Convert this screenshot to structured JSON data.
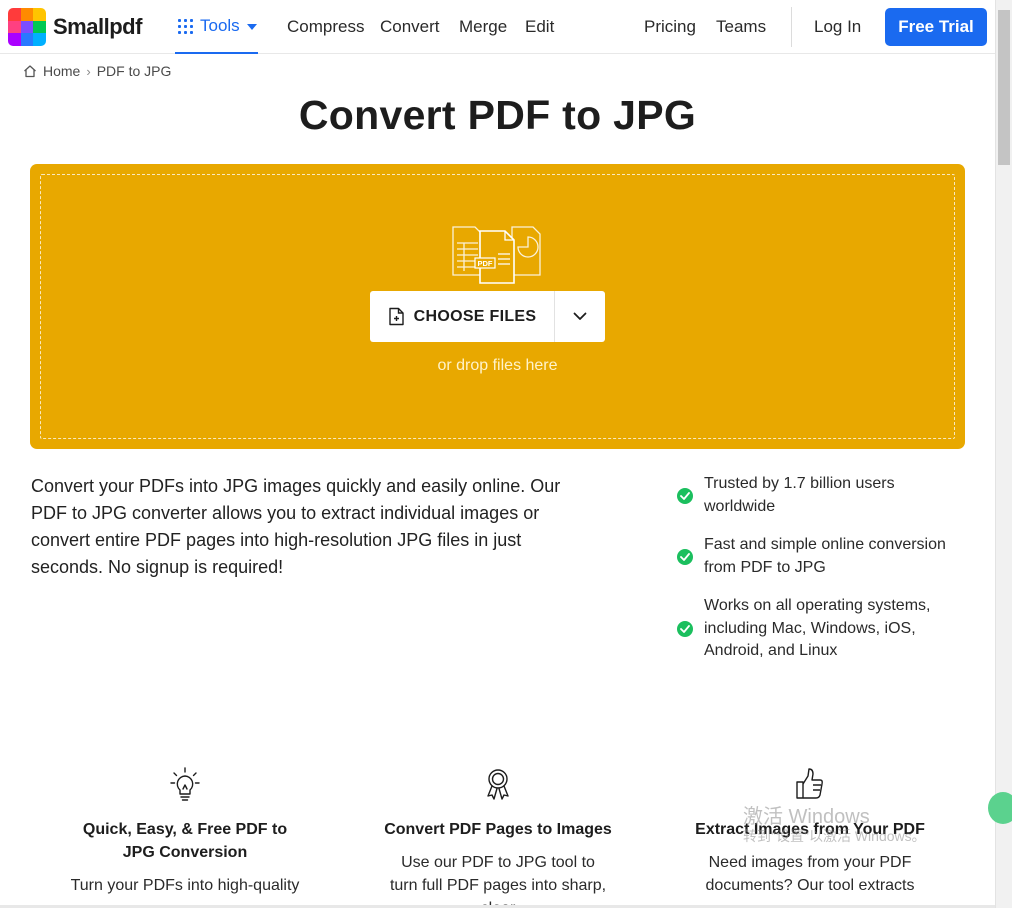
{
  "brand": {
    "name": "Smallpdf",
    "logo_colors": [
      "#ff3b3b",
      "#ff8a00",
      "#ffc400",
      "#00c853",
      "#00b0ff",
      "#7c4dff",
      "#ff4081",
      "#2979ff",
      "#aa00ff"
    ]
  },
  "nav": {
    "tools_label": "Tools",
    "links": [
      "Compress",
      "Convert",
      "Merge",
      "Edit"
    ],
    "pricing": "Pricing",
    "teams": "Teams",
    "login": "Log In",
    "trial": "Free Trial"
  },
  "breadcrumb": {
    "home": "Home",
    "current": "PDF to JPG"
  },
  "title": "Convert PDF to JPG",
  "dropzone": {
    "choose_label": "CHOOSE FILES",
    "hint": "or drop files here",
    "accent": "#e8a800"
  },
  "intro": "Convert your PDFs into JPG images quickly and easily online. Our PDF to JPG converter allows you to extract individual images or convert entire PDF pages into high-resolution JPG files in just seconds. No signup is required!",
  "features": [
    "Trusted by 1.7 billion users worldwide",
    "Fast and simple online conversion from PDF to JPG",
    "Works on all operating systems, including Mac, Windows, iOS, Android, and Linux"
  ],
  "columns": [
    {
      "icon": "lightbulb-icon",
      "title": "Quick, Easy, & Free PDF to JPG Conversion",
      "text": "Turn your PDFs into high-quality"
    },
    {
      "icon": "award-ribbon-icon",
      "title": "Convert PDF Pages to Images",
      "text": "Use our PDF to JPG tool to turn full PDF pages into sharp, clear"
    },
    {
      "icon": "thumbs-up-icon",
      "title": "Extract Images from Your PDF",
      "text": "Need images from your PDF documents? Our tool extracts"
    }
  ],
  "watermark": {
    "line1": "激活 Windows",
    "line2": "转到\"设置\"以激活 Windows。"
  },
  "colors": {
    "primary": "#1a6af0",
    "check": "#1bbf5e"
  }
}
